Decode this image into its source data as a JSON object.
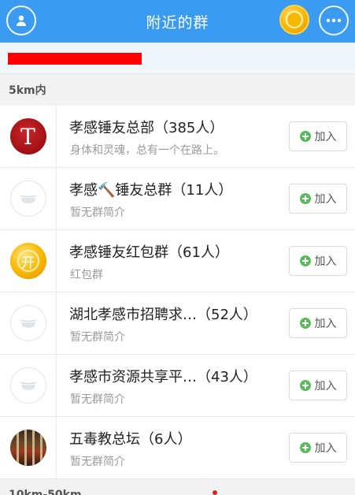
{
  "header": {
    "title": "附近的群",
    "left_icon": "profile-icon",
    "coin_icon": "coin-icon",
    "right_icon": "more-icon",
    "accent_color": "#3a9bf0"
  },
  "sections": {
    "near": "5km内",
    "far": "10km-50km"
  },
  "groups": [
    {
      "name": "孝感锤友总部（385人）",
      "desc": "身体和灵魂，总有一个在路上。",
      "avatar": "red-t",
      "join": "加入"
    },
    {
      "name": "孝感🔨锤友总群（11人）",
      "desc": "暂无群简介",
      "avatar": "empty",
      "join": "加入"
    },
    {
      "name": "孝感锤友红包群（61人）",
      "desc": "红包群",
      "avatar": "coin",
      "join": "加入"
    },
    {
      "name": "湖北孝感市招聘求…（52人）",
      "desc": "暂无群简介",
      "avatar": "empty",
      "join": "加入"
    },
    {
      "name": "孝感市资源共享平…（43人）",
      "desc": "暂无群简介",
      "avatar": "empty",
      "join": "加入"
    },
    {
      "name": "五毒教总坛（6人）",
      "desc": "暂无群简介",
      "avatar": "photo",
      "join": "加入"
    }
  ],
  "avatar_glyphs": {
    "red_t": "T",
    "coin": "开"
  }
}
